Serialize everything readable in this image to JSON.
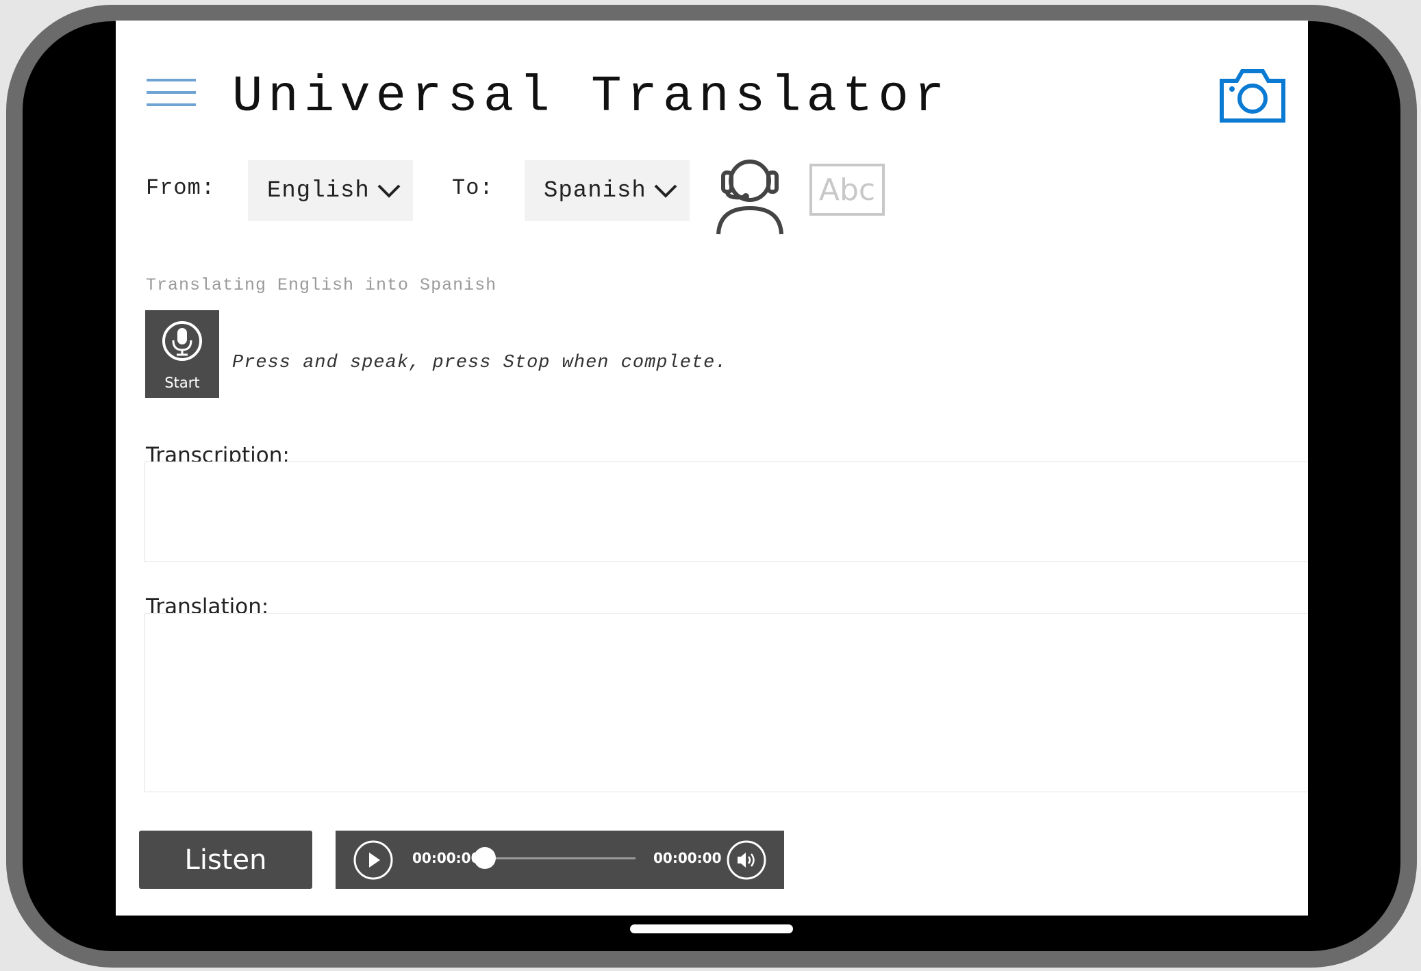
{
  "header": {
    "title": "Universal Translator"
  },
  "languages": {
    "from_label": "From:",
    "from_value": "English",
    "to_label": "To:",
    "to_value": "Spanish"
  },
  "mode_icons": {
    "voice": "headset-person-icon",
    "text": "Abc"
  },
  "status": "Translating English into Spanish",
  "recorder": {
    "start_label": "Start",
    "instruction": "Press and speak, press Stop when complete."
  },
  "transcription": {
    "label": "Transcription:",
    "value": ""
  },
  "translation": {
    "label": "Translation:",
    "value": ""
  },
  "player": {
    "listen_label": "Listen",
    "current_time": "00:00:00",
    "total_time": "00:00:00",
    "progress": 0
  },
  "colors": {
    "accent": "#0a7ad2",
    "menu": "#6fa3d4",
    "dark_button": "#4b4b4b",
    "muted_text": "#9a9a9a"
  }
}
